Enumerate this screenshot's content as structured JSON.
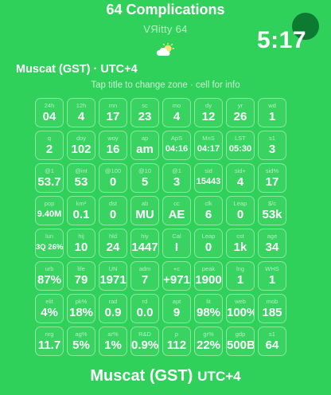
{
  "header": {
    "title": "64 Complications",
    "brand": "VЯitty 64",
    "time": "5:17",
    "zone_line": "Muscat (GST) · UTC+4",
    "hint": "Tap title to change zone · cell for info"
  },
  "footer": {
    "zone": "Muscat (GST)",
    "utc": "UTC+4"
  },
  "cells": [
    {
      "l": "24h",
      "v": "04"
    },
    {
      "l": "12h",
      "v": "4"
    },
    {
      "l": "mn",
      "v": "17"
    },
    {
      "l": "sc",
      "v": "23"
    },
    {
      "l": "mo",
      "v": "4"
    },
    {
      "l": "dy",
      "v": "12"
    },
    {
      "l": "yr",
      "v": "26"
    },
    {
      "l": "wd",
      "v": "1"
    },
    {
      "l": "q",
      "v": "2"
    },
    {
      "l": "doy",
      "v": "102"
    },
    {
      "l": "woy",
      "v": "16"
    },
    {
      "l": "ap",
      "v": "am"
    },
    {
      "l": "ApS",
      "v": "04:16"
    },
    {
      "l": "MnS",
      "v": "04:17"
    },
    {
      "l": "LST",
      "v": "05:30"
    },
    {
      "l": "s1",
      "v": "3"
    },
    {
      "l": "@1",
      "v": "53.7"
    },
    {
      "l": "@int",
      "v": "53"
    },
    {
      "l": "@100",
      "v": "0"
    },
    {
      "l": "@10",
      "v": "5"
    },
    {
      "l": "@1",
      "v": "3"
    },
    {
      "l": "sid",
      "v": "15443"
    },
    {
      "l": "sid+",
      "v": "4"
    },
    {
      "l": "sid%",
      "v": "17"
    },
    {
      "l": "pop",
      "v": "9.40M"
    },
    {
      "l": "km²",
      "v": "0.1"
    },
    {
      "l": "dst",
      "v": "0"
    },
    {
      "l": "ab",
      "v": "MU"
    },
    {
      "l": "cc",
      "v": "AE"
    },
    {
      "l": "clk",
      "v": "6"
    },
    {
      "l": "Leap",
      "v": "0"
    },
    {
      "l": "$/c",
      "v": "53k"
    },
    {
      "l": "lun",
      "v": "3Q 26%"
    },
    {
      "l": "hij",
      "v": "10"
    },
    {
      "l": "hld",
      "v": "24"
    },
    {
      "l": "hiy",
      "v": "1447"
    },
    {
      "l": "Cal",
      "v": "I"
    },
    {
      "l": "Leap",
      "v": "0"
    },
    {
      "l": "cst",
      "v": "1k"
    },
    {
      "l": "age",
      "v": "34"
    },
    {
      "l": "urb",
      "v": "87%"
    },
    {
      "l": "life",
      "v": "79"
    },
    {
      "l": "UN",
      "v": "1971"
    },
    {
      "l": "adm",
      "v": "7"
    },
    {
      "l": "+c",
      "v": "+971"
    },
    {
      "l": "peak",
      "v": "1900"
    },
    {
      "l": "lng",
      "v": "1"
    },
    {
      "l": "WHS",
      "v": "1"
    },
    {
      "l": "elit",
      "v": "4%"
    },
    {
      "l": "pk%",
      "v": "18%"
    },
    {
      "l": "rad",
      "v": "0.9"
    },
    {
      "l": "rd",
      "v": "0.0"
    },
    {
      "l": "apt",
      "v": "9"
    },
    {
      "l": "lit",
      "v": "98%"
    },
    {
      "l": "web",
      "v": "100%"
    },
    {
      "l": "mob",
      "v": "185"
    },
    {
      "l": "nrg",
      "v": "11.7"
    },
    {
      "l": "ag%",
      "v": "5%"
    },
    {
      "l": "ar%",
      "v": "1%"
    },
    {
      "l": "R&D",
      "v": "0.9%"
    },
    {
      "l": "p",
      "v": "112"
    },
    {
      "l": "gr%",
      "v": "22%"
    },
    {
      "l": "gdp",
      "v": "500B"
    },
    {
      "l": "s1",
      "v": "64"
    }
  ]
}
